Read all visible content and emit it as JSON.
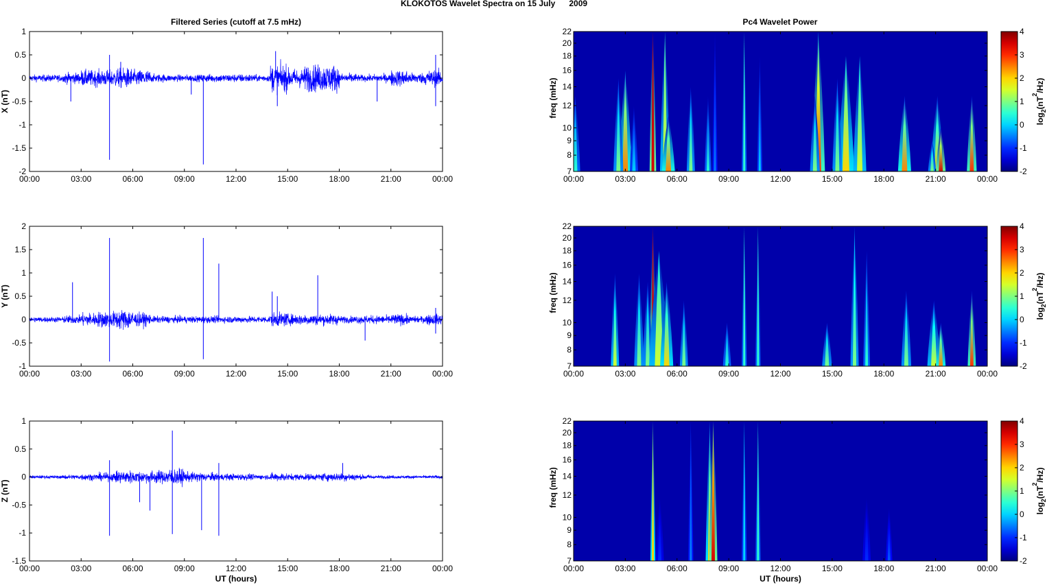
{
  "chart_data": {
    "type": "multi-panel: line + heatmap",
    "title": "KLOKOTOS Wavelet Spectra on 15 July      2009",
    "left_title": "Filtered Series (cutoff at 7.5 mHz)",
    "right_title": "Pc4 Wavelet Power",
    "xlabel": "UT (hours)",
    "x_ticks": [
      "00:00",
      "03:00",
      "06:00",
      "09:00",
      "12:00",
      "15:00",
      "18:00",
      "21:00",
      "00:00"
    ],
    "x_range_hours": [
      0,
      24
    ],
    "freq_label": "freq (mHz)",
    "freq_scale": "log",
    "freq_range": [
      7,
      22
    ],
    "freq_ticks": [
      "7",
      "8",
      "9",
      "10",
      "12",
      "14",
      "16",
      "18",
      "20",
      "22"
    ],
    "colorbar": {
      "range": [
        -2,
        4
      ],
      "ticks": [
        "4",
        "3",
        "2",
        "1",
        "0",
        "-1",
        "-2"
      ],
      "label_parts": [
        "log",
        "2",
        "(nT",
        "2",
        "/Hz)"
      ],
      "colormap": "jet",
      "background_power": -1.75
    },
    "line_color": "#0000ff",
    "series": [
      {
        "name": "X",
        "ylabel": "X (nT)",
        "ylim": [
          -2,
          1
        ],
        "y_ticks": [
          "1",
          "0.5",
          "0",
          "-0.5",
          "-1",
          "-1.5",
          "-2"
        ],
        "hourly_noise_amplitude": [
          0.05,
          0.05,
          0.08,
          0.12,
          0.12,
          0.15,
          0.12,
          0.06,
          0.05,
          0.05,
          0.06,
          0.06,
          0.06,
          0.05,
          0.2,
          0.14,
          0.2,
          0.2,
          0.07,
          0.05,
          0.06,
          0.12,
          0.08,
          0.12
        ],
        "spikes": [
          [
            4.65,
            -1.75
          ],
          [
            4.65,
            0.5
          ],
          [
            10.1,
            -1.85
          ],
          [
            14.3,
            0.58
          ],
          [
            14.4,
            -0.6
          ],
          [
            23.6,
            0.5
          ],
          [
            23.6,
            -0.6
          ],
          [
            2.4,
            -0.5
          ],
          [
            20.2,
            -0.5
          ],
          [
            5.3,
            0.35
          ],
          [
            9.4,
            -0.35
          ]
        ],
        "wavelet_streaks": [
          [
            4.6,
            7,
            22,
            3.5,
            3.5,
            4
          ],
          [
            5.3,
            7,
            22,
            1.5,
            0.5,
            6
          ],
          [
            5.5,
            7,
            11,
            2.5,
            -1,
            8
          ],
          [
            3.0,
            7,
            16,
            2.5,
            -0.5,
            8
          ],
          [
            2.6,
            7,
            15,
            1,
            -1,
            6
          ],
          [
            3.5,
            7,
            12,
            0,
            -1.5,
            5
          ],
          [
            6.8,
            7,
            14,
            1,
            -1,
            5
          ],
          [
            7.8,
            7,
            13,
            0.5,
            -1.5,
            4
          ],
          [
            8.2,
            7,
            22,
            -0.5,
            -1.5,
            3
          ],
          [
            9.9,
            7,
            22,
            0.5,
            0.5,
            3
          ],
          [
            10.8,
            7,
            18,
            0,
            -1.5,
            3
          ],
          [
            14.2,
            7,
            22,
            3,
            0,
            8
          ],
          [
            14.0,
            7,
            13,
            1,
            -1,
            6
          ],
          [
            15.8,
            7,
            18,
            2,
            0,
            10
          ],
          [
            15.3,
            7,
            15,
            1,
            -1,
            6
          ],
          [
            16.6,
            7,
            18,
            1.5,
            0,
            8
          ],
          [
            19.2,
            7,
            13,
            2.5,
            -1,
            8
          ],
          [
            21.1,
            7,
            13,
            2,
            -1,
            8
          ],
          [
            21.3,
            7,
            10,
            3.5,
            -1,
            6
          ],
          [
            20.8,
            7,
            9,
            1,
            -1,
            5
          ],
          [
            23.1,
            7,
            13,
            3,
            -1,
            6
          ],
          [
            0.1,
            7,
            13,
            0.5,
            -1,
            6
          ]
        ]
      },
      {
        "name": "Y",
        "ylabel": "Y (nT)",
        "ylim": [
          -1,
          2
        ],
        "y_ticks": [
          "2",
          "1.5",
          "1",
          "0.5",
          "0",
          "-0.5",
          "-1"
        ],
        "hourly_noise_amplitude": [
          0.04,
          0.04,
          0.06,
          0.1,
          0.12,
          0.15,
          0.1,
          0.05,
          0.05,
          0.05,
          0.05,
          0.05,
          0.05,
          0.05,
          0.1,
          0.08,
          0.08,
          0.08,
          0.05,
          0.06,
          0.06,
          0.08,
          0.05,
          0.08
        ],
        "spikes": [
          [
            4.65,
            1.75
          ],
          [
            4.65,
            -0.9
          ],
          [
            10.1,
            1.75
          ],
          [
            10.1,
            -0.85
          ],
          [
            11,
            1.2
          ],
          [
            2.5,
            0.8
          ],
          [
            16.75,
            0.95
          ],
          [
            19.5,
            -0.45
          ],
          [
            23.6,
            0.25
          ],
          [
            23.6,
            -0.3
          ],
          [
            14.1,
            0.6
          ],
          [
            14.4,
            0.5
          ]
        ],
        "wavelet_streaks": [
          [
            4.6,
            7,
            22,
            3.5,
            3.5,
            4
          ],
          [
            2.4,
            7,
            15,
            1.5,
            -1,
            5
          ],
          [
            3.8,
            7,
            15,
            1,
            -1,
            6
          ],
          [
            4.3,
            7,
            14,
            1,
            -1,
            6
          ],
          [
            4.95,
            7,
            18,
            1.5,
            0,
            12
          ],
          [
            5.4,
            7,
            14,
            2,
            -1,
            8
          ],
          [
            6.4,
            7,
            12,
            1,
            -1,
            5
          ],
          [
            9.9,
            7,
            22,
            0.5,
            0.5,
            3
          ],
          [
            10.7,
            7,
            22,
            0.5,
            0.5,
            3
          ],
          [
            8.9,
            7,
            10,
            0.5,
            -1,
            5
          ],
          [
            14.7,
            7,
            10,
            1,
            -1,
            6
          ],
          [
            16.3,
            7,
            22,
            1,
            -0.5,
            5
          ],
          [
            17.0,
            7,
            18,
            0.5,
            -1,
            4
          ],
          [
            19.3,
            7,
            13,
            1,
            -1,
            6
          ],
          [
            20.9,
            7,
            12,
            1.5,
            -1,
            8
          ],
          [
            21.3,
            7,
            10,
            2.5,
            -1,
            6
          ],
          [
            23.1,
            7,
            13,
            3,
            -1,
            5
          ]
        ]
      },
      {
        "name": "Z",
        "ylabel": "Z (nT)",
        "ylim": [
          -1.5,
          1
        ],
        "y_ticks": [
          "1",
          "0.5",
          "0",
          "-0.5",
          "-1",
          "-1.5"
        ],
        "hourly_noise_amplitude": [
          0.02,
          0.02,
          0.03,
          0.04,
          0.05,
          0.08,
          0.07,
          0.08,
          0.1,
          0.06,
          0.05,
          0.04,
          0.04,
          0.03,
          0.05,
          0.04,
          0.04,
          0.05,
          0.05,
          0.03,
          0.02,
          0.02,
          0.02,
          0.02
        ],
        "spikes": [
          [
            8.3,
            0.83
          ],
          [
            8.3,
            -1.02
          ],
          [
            4.65,
            -1.05
          ],
          [
            4.65,
            0.3
          ],
          [
            11,
            -1.05
          ],
          [
            10,
            -0.95
          ],
          [
            7,
            -0.6
          ],
          [
            11,
            0.25
          ],
          [
            18.2,
            0.25
          ],
          [
            6.4,
            -0.45
          ]
        ],
        "wavelet_streaks": [
          [
            4.6,
            7,
            22,
            2,
            1,
            3
          ],
          [
            6.8,
            7,
            22,
            -0.5,
            -1,
            3
          ],
          [
            7.9,
            7,
            22,
            2,
            -0.5,
            5
          ],
          [
            8.1,
            7,
            22,
            3.5,
            1,
            5
          ],
          [
            9.9,
            7,
            22,
            0,
            0,
            3
          ],
          [
            10.7,
            7,
            22,
            0.5,
            0.5,
            3
          ],
          [
            5.0,
            7,
            12,
            -1,
            -1.8,
            5
          ],
          [
            17,
            7,
            12,
            -1,
            -1.8,
            5
          ],
          [
            18.3,
            7,
            11,
            -0.7,
            -1.8,
            4
          ]
        ]
      }
    ]
  }
}
